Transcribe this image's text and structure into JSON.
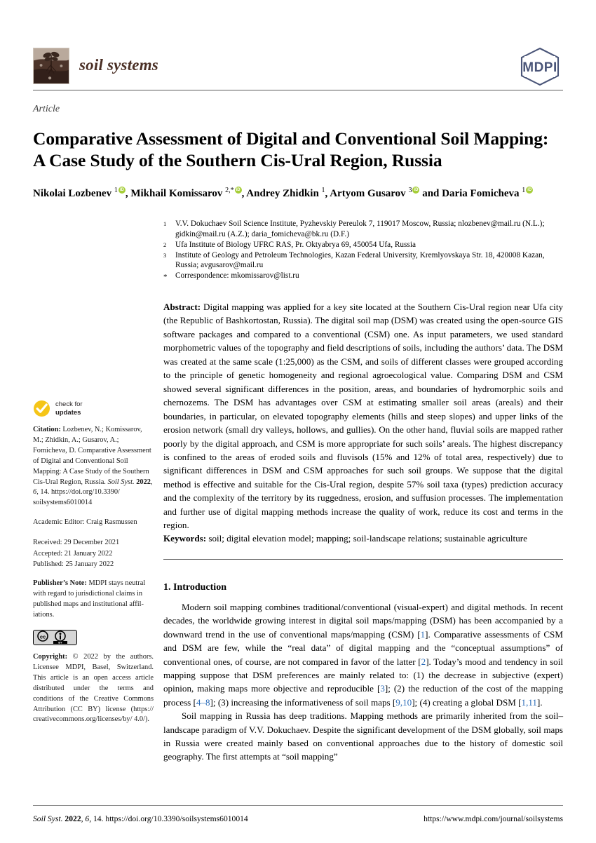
{
  "header": {
    "journal_name": "soil systems",
    "publisher_logo_text": "MDPI",
    "logo_icon": "seedling-soil-logo"
  },
  "article": {
    "type_label": "Article",
    "title": "Comparative Assessment of Digital and Conventional Soil Mapping: A Case Study of the Southern Cis-Ural Region, Russia",
    "authors_html": "Nikolai Lozbenev <sup>1</sup><span class=\"orcid\" data-name=\"orcid-icon\" data-interactable=\"true\"></span>, Mikhail Komissarov <sup>2,*</sup><span class=\"orcid\" data-name=\"orcid-icon\" data-interactable=\"true\"></span>, Andrey Zhidkin <sup>1</sup>, Artyom Gusarov <sup>3</sup><span class=\"orcid\" data-name=\"orcid-icon\" data-interactable=\"true\"></span> and Daria Fomicheva <sup>1</sup><span class=\"orcid\" data-name=\"orcid-icon\" data-interactable=\"true\"></span>"
  },
  "affiliations": [
    {
      "marker": "1",
      "text": "V.V. Dokuchaev Soil Science Institute, Pyzhevskiy Pereulok 7, 119017 Moscow, Russia; nlozbenev@mail.ru (N.L.); gidkin@mail.ru (A.Z.); daria_fomicheva@bk.ru (D.F.)"
    },
    {
      "marker": "2",
      "text": "Ufa Institute of Biology UFRC RAS, Pr. Oktyabrya 69, 450054 Ufa, Russia"
    },
    {
      "marker": "3",
      "text": "Institute of Geology and Petroleum Technologies, Kazan Federal University, Kremlyovskaya Str. 18, 420008 Kazan, Russia; avgusarov@mail.ru"
    },
    {
      "marker": "*",
      "text": "Correspondence: mkomissarov@list.ru"
    }
  ],
  "abstract": {
    "label": "Abstract:",
    "text": "Digital mapping was applied for a key site located at the Southern Cis-Ural region near Ufa city (the Republic of Bashkortostan, Russia). The digital soil map (DSM) was created using the open-source GIS software packages and compared to a conventional (CSM) one. As input parameters, we used standard morphometric values of the topography and field descriptions of soils, including the authors’ data. The DSM was created at the same scale (1:25,000) as the CSM, and soils of different classes were grouped according to the principle of genetic homogeneity and regional agroecological value. Comparing DSM and CSM showed several significant differences in the position, areas, and boundaries of hydromorphic soils and chernozems. The DSM has advantages over CSM at estimating smaller soil areas (areals) and their boundaries, in particular, on elevated topography elements (hills and steep slopes) and upper links of the erosion network (small dry valleys, hollows, and gullies). On the other hand, fluvial soils are mapped rather poorly by the digital approach, and CSM is more appropriate for such soils’ areals. The highest discrepancy is confined to the areas of eroded soils and fluvisols (15% and 12% of total area, respectively) due to significant differences in DSM and CSM approaches for such soil groups. We suppose that the digital method is effective and suitable for the Cis-Ural region, despite 57% soil taxa (types) prediction accuracy and the complexity of the territory by its ruggedness, erosion, and suffusion processes. The implementation and further use of digital mapping methods increase the quality of work, reduce its cost and terms in the region."
  },
  "keywords": {
    "label": "Keywords:",
    "text": "soil; digital elevation model; mapping; soil-landscape relations; sustainable agriculture"
  },
  "introduction": {
    "heading": "1. Introduction",
    "paragraph1_html": "Modern soil mapping combines traditional/conventional (visual-expert) and digital methods. In recent decades, the worldwide growing interest in digital soil maps/mapping (DSM) has been accompanied by a downward trend in the use of conventional maps/mapping (CSM) [<span class=\"ref\">1</span>]. Comparative assessments of CSM and DSM are few, while the “real data” of digital mapping and the “conceptual assumptions” of conventional ones, of course, are not compared in favor of the latter [<span class=\"ref\">2</span>]. Today’s mood and tendency in soil mapping suppose that DSM preferences are mainly related to: (1) the decrease in subjective (expert) opinion, making maps more objective and reproducible [<span class=\"ref\">3</span>]; (2) the reduction of the cost of the mapping process [<span class=\"ref\">4–8</span>]; (3) increasing the informativeness of soil maps [<span class=\"ref\">9,10</span>]; (4) creating a global DSM [<span class=\"ref\">1,11</span>].",
    "paragraph2_html": "Soil mapping in Russia has deep traditions. Mapping methods are primarily inherited from the soil–landscape paradigm of V.V. Dokuchaev. Despite the significant development of the DSM globally, soil maps in Russia were created mainly based on conventional approaches due to the history of domestic soil geography. The first attempts at “soil mapping”"
  },
  "sidebar": {
    "check_updates": {
      "line1": "check for",
      "line2": "updates",
      "icon": "check-circle-icon"
    },
    "citation_html": "<b>Citation:</b> Lozbenev, N.; Komissarov, M.; Zhidkin, A.; Gusarov, A.; Fomicheva, D. Comparative Assessment of Digital and Conventional Soil Mapping: A Case Study of the Southern Cis-Ural Region, Russia. <i>Soil Syst.</i> <b>2022</b>, <i>6</i>, 14. https://doi.org/10.3390/ soilsystems6010014",
    "academic_editor": "Academic Editor: Craig Rasmussen",
    "dates": [
      "Received: 29 December 2021",
      "Accepted: 21 January 2022",
      "Published: 25 January 2022"
    ],
    "publisher_note_html": "<b>Publisher’s Note:</b> MDPI stays neutral with regard to jurisdictional claims in published maps and institutional affil-iations.",
    "cc_badge": {
      "icon": "creative-commons-by-badge",
      "cc_label": "cc",
      "by_label": "BY"
    },
    "copyright_html": "<b>Copyright:</b> © 2022 by the authors. Licensee MDPI, Basel, Switzerland. This article is an open access article distributed under the terms and conditions of the Creative Commons Attribution (CC BY) license (https:// creativecommons.org/licenses/by/ 4.0/)."
  },
  "footer": {
    "left_html": "<i>Soil Syst.</i> <b>2022</b>, <i>6</i>, 14. https://doi.org/10.3390/soilsystems6010014",
    "right": "https://www.mdpi.com/journal/soilsystems"
  },
  "colors": {
    "journal_brown": "#4a2f25",
    "mdpi_blue": "#4a5578",
    "orcid_green": "#a6ce39",
    "check_yellow": "#f5c518",
    "reference_blue": "#2b6cb8"
  }
}
